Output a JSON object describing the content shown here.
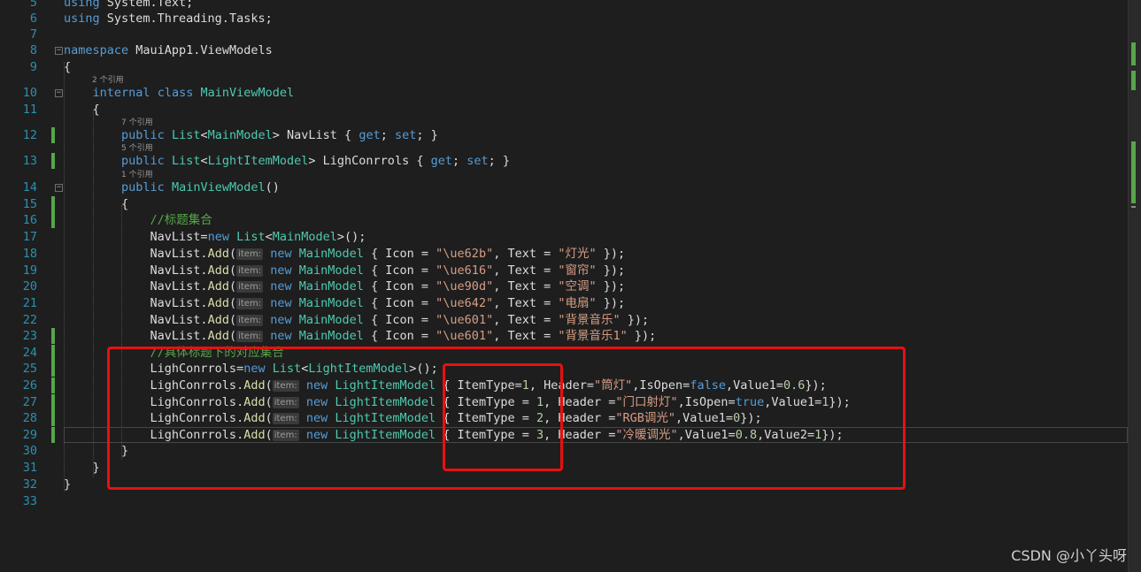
{
  "editor": {
    "lines": [
      {
        "n": "5",
        "tokens": [
          {
            "t": "using",
            "c": "kw"
          },
          {
            "t": " System.Text;"
          }
        ]
      },
      {
        "n": "6",
        "tokens": [
          {
            "t": "using",
            "c": "kw"
          },
          {
            "t": " System.Threading.Tasks;"
          }
        ]
      },
      {
        "n": "7",
        "tokens": []
      },
      {
        "n": "8",
        "tokens": [
          {
            "t": "namespace",
            "c": "kw"
          },
          {
            "t": " MauiApp1.ViewModels"
          }
        ]
      },
      {
        "n": "9",
        "tokens": [
          {
            "t": "{"
          }
        ]
      },
      {
        "n": "10",
        "lens": "2 个引用",
        "tokens": [
          {
            "t": "    "
          },
          {
            "t": "internal",
            "c": "kw"
          },
          {
            "t": " "
          },
          {
            "t": "class",
            "c": "kw"
          },
          {
            "t": " "
          },
          {
            "t": "MainViewModel",
            "c": "ty"
          }
        ]
      },
      {
        "n": "11",
        "tokens": [
          {
            "t": "    {"
          }
        ]
      },
      {
        "n": "12",
        "lens": "7 个引用",
        "tokens": [
          {
            "t": "        "
          },
          {
            "t": "public",
            "c": "kw"
          },
          {
            "t": " "
          },
          {
            "t": "List",
            "c": "ty"
          },
          {
            "t": "<"
          },
          {
            "t": "MainModel",
            "c": "ty"
          },
          {
            "t": "> NavList { "
          },
          {
            "t": "get",
            "c": "kw"
          },
          {
            "t": "; "
          },
          {
            "t": "set",
            "c": "kw"
          },
          {
            "t": "; }"
          }
        ]
      },
      {
        "n": "13",
        "lens": "5 个引用",
        "tokens": [
          {
            "t": "        "
          },
          {
            "t": "public",
            "c": "kw"
          },
          {
            "t": " "
          },
          {
            "t": "List",
            "c": "ty"
          },
          {
            "t": "<"
          },
          {
            "t": "LightItemModel",
            "c": "ty"
          },
          {
            "t": "> LighConrrols { "
          },
          {
            "t": "get",
            "c": "kw"
          },
          {
            "t": "; "
          },
          {
            "t": "set",
            "c": "kw"
          },
          {
            "t": "; }"
          }
        ]
      },
      {
        "n": "14",
        "lens": "1 个引用",
        "tokens": [
          {
            "t": "        "
          },
          {
            "t": "public",
            "c": "kw"
          },
          {
            "t": " "
          },
          {
            "t": "MainViewModel",
            "c": "ty"
          },
          {
            "t": "()"
          }
        ]
      },
      {
        "n": "15",
        "tokens": [
          {
            "t": "        {"
          }
        ]
      },
      {
        "n": "16",
        "tokens": [
          {
            "t": "            "
          },
          {
            "t": "//标题集合",
            "c": "cm"
          }
        ]
      },
      {
        "n": "17",
        "tokens": [
          {
            "t": "            NavList="
          },
          {
            "t": "new",
            "c": "kw"
          },
          {
            "t": " "
          },
          {
            "t": "List",
            "c": "ty"
          },
          {
            "t": "<"
          },
          {
            "t": "MainModel",
            "c": "ty"
          },
          {
            "t": ">();"
          }
        ]
      },
      {
        "n": "18",
        "tokens": [
          {
            "t": "            NavList."
          },
          {
            "t": "Add",
            "c": "mt"
          },
          {
            "t": "("
          },
          {
            "t": "item:",
            "c": "hint"
          },
          {
            "t": " "
          },
          {
            "t": "new",
            "c": "kw"
          },
          {
            "t": " "
          },
          {
            "t": "MainModel",
            "c": "ty"
          },
          {
            "t": " { Icon = "
          },
          {
            "t": "\"\\ue62b\"",
            "c": "st"
          },
          {
            "t": ", Text = "
          },
          {
            "t": "\"灯光\"",
            "c": "st"
          },
          {
            "t": " });"
          }
        ]
      },
      {
        "n": "19",
        "tokens": [
          {
            "t": "            NavList."
          },
          {
            "t": "Add",
            "c": "mt"
          },
          {
            "t": "("
          },
          {
            "t": "item:",
            "c": "hint"
          },
          {
            "t": " "
          },
          {
            "t": "new",
            "c": "kw"
          },
          {
            "t": " "
          },
          {
            "t": "MainModel",
            "c": "ty"
          },
          {
            "t": " { Icon = "
          },
          {
            "t": "\"\\ue616\"",
            "c": "st"
          },
          {
            "t": ", Text = "
          },
          {
            "t": "\"窗帘\"",
            "c": "st"
          },
          {
            "t": " });"
          }
        ]
      },
      {
        "n": "20",
        "tokens": [
          {
            "t": "            NavList."
          },
          {
            "t": "Add",
            "c": "mt"
          },
          {
            "t": "("
          },
          {
            "t": "item:",
            "c": "hint"
          },
          {
            "t": " "
          },
          {
            "t": "new",
            "c": "kw"
          },
          {
            "t": " "
          },
          {
            "t": "MainModel",
            "c": "ty"
          },
          {
            "t": " { Icon = "
          },
          {
            "t": "\"\\ue90d\"",
            "c": "st"
          },
          {
            "t": ", Text = "
          },
          {
            "t": "\"空调\"",
            "c": "st"
          },
          {
            "t": " });"
          }
        ]
      },
      {
        "n": "21",
        "tokens": [
          {
            "t": "            NavList."
          },
          {
            "t": "Add",
            "c": "mt"
          },
          {
            "t": "("
          },
          {
            "t": "item:",
            "c": "hint"
          },
          {
            "t": " "
          },
          {
            "t": "new",
            "c": "kw"
          },
          {
            "t": " "
          },
          {
            "t": "MainModel",
            "c": "ty"
          },
          {
            "t": " { Icon = "
          },
          {
            "t": "\"\\ue642\"",
            "c": "st"
          },
          {
            "t": ", Text = "
          },
          {
            "t": "\"电扇\"",
            "c": "st"
          },
          {
            "t": " });"
          }
        ]
      },
      {
        "n": "22",
        "tokens": [
          {
            "t": "            NavList."
          },
          {
            "t": "Add",
            "c": "mt"
          },
          {
            "t": "("
          },
          {
            "t": "item:",
            "c": "hint"
          },
          {
            "t": " "
          },
          {
            "t": "new",
            "c": "kw"
          },
          {
            "t": " "
          },
          {
            "t": "MainModel",
            "c": "ty"
          },
          {
            "t": " { Icon = "
          },
          {
            "t": "\"\\ue601\"",
            "c": "st"
          },
          {
            "t": ", Text = "
          },
          {
            "t": "\"背景音乐\"",
            "c": "st"
          },
          {
            "t": " });"
          }
        ]
      },
      {
        "n": "23",
        "tokens": [
          {
            "t": "            NavList."
          },
          {
            "t": "Add",
            "c": "mt"
          },
          {
            "t": "("
          },
          {
            "t": "item:",
            "c": "hint"
          },
          {
            "t": " "
          },
          {
            "t": "new",
            "c": "kw"
          },
          {
            "t": " "
          },
          {
            "t": "MainModel",
            "c": "ty"
          },
          {
            "t": " { Icon = "
          },
          {
            "t": "\"\\ue601\"",
            "c": "st"
          },
          {
            "t": ", Text = "
          },
          {
            "t": "\"背景音乐1\"",
            "c": "st"
          },
          {
            "t": " });"
          }
        ]
      },
      {
        "n": "24",
        "tokens": [
          {
            "t": "            "
          },
          {
            "t": "//具体标题下的对应集合",
            "c": "cm"
          }
        ]
      },
      {
        "n": "25",
        "tokens": [
          {
            "t": "            LighConrrols="
          },
          {
            "t": "new",
            "c": "kw"
          },
          {
            "t": " "
          },
          {
            "t": "List",
            "c": "ty"
          },
          {
            "t": "<"
          },
          {
            "t": "LightItemModel",
            "c": "ty"
          },
          {
            "t": ">();"
          }
        ]
      },
      {
        "n": "26",
        "tokens": [
          {
            "t": "            LighConrrols."
          },
          {
            "t": "Add",
            "c": "mt"
          },
          {
            "t": "("
          },
          {
            "t": "item:",
            "c": "hint"
          },
          {
            "t": " "
          },
          {
            "t": "new",
            "c": "kw"
          },
          {
            "t": " "
          },
          {
            "t": "LightItemModel",
            "c": "ty"
          },
          {
            "t": " { ItemType="
          },
          {
            "t": "1",
            "c": "nu"
          },
          {
            "t": ", Header="
          },
          {
            "t": "\"筒灯\"",
            "c": "st"
          },
          {
            "t": ",IsOpen="
          },
          {
            "t": "false",
            "c": "kw"
          },
          {
            "t": ",Value1="
          },
          {
            "t": "0.6",
            "c": "nu"
          },
          {
            "t": "});"
          }
        ]
      },
      {
        "n": "27",
        "tokens": [
          {
            "t": "            LighConrrols."
          },
          {
            "t": "Add",
            "c": "mt"
          },
          {
            "t": "("
          },
          {
            "t": "item:",
            "c": "hint"
          },
          {
            "t": " "
          },
          {
            "t": "new",
            "c": "kw"
          },
          {
            "t": " "
          },
          {
            "t": "LightItemModel",
            "c": "ty"
          },
          {
            "t": " { ItemType = "
          },
          {
            "t": "1",
            "c": "nu"
          },
          {
            "t": ", Header ="
          },
          {
            "t": "\"门口射灯\"",
            "c": "st"
          },
          {
            "t": ",IsOpen="
          },
          {
            "t": "true",
            "c": "kw"
          },
          {
            "t": ",Value1="
          },
          {
            "t": "1",
            "c": "nu"
          },
          {
            "t": "});"
          }
        ]
      },
      {
        "n": "28",
        "tokens": [
          {
            "t": "            LighConrrols."
          },
          {
            "t": "Add",
            "c": "mt"
          },
          {
            "t": "("
          },
          {
            "t": "item:",
            "c": "hint"
          },
          {
            "t": " "
          },
          {
            "t": "new",
            "c": "kw"
          },
          {
            "t": " "
          },
          {
            "t": "LightItemModel",
            "c": "ty"
          },
          {
            "t": " { ItemType = "
          },
          {
            "t": "2",
            "c": "nu"
          },
          {
            "t": ", Header ="
          },
          {
            "t": "\"RGB调光\"",
            "c": "st"
          },
          {
            "t": ",Value1="
          },
          {
            "t": "0",
            "c": "nu"
          },
          {
            "t": "});"
          }
        ]
      },
      {
        "n": "29",
        "tokens": [
          {
            "t": "            LighConrrols."
          },
          {
            "t": "Add",
            "c": "mt"
          },
          {
            "t": "("
          },
          {
            "t": "item:",
            "c": "hint"
          },
          {
            "t": " "
          },
          {
            "t": "new",
            "c": "kw"
          },
          {
            "t": " "
          },
          {
            "t": "LightItemModel",
            "c": "ty"
          },
          {
            "t": " { ItemType = "
          },
          {
            "t": "3",
            "c": "nu"
          },
          {
            "t": ", Header ="
          },
          {
            "t": "\"冷暖调光\"",
            "c": "st"
          },
          {
            "t": ",Value1="
          },
          {
            "t": "0.8",
            "c": "nu"
          },
          {
            "t": ",Value2="
          },
          {
            "t": "1",
            "c": "nu"
          },
          {
            "t": "});"
          }
        ]
      },
      {
        "n": "30",
        "tokens": [
          {
            "t": "        }"
          }
        ]
      },
      {
        "n": "31",
        "tokens": [
          {
            "t": "    }"
          }
        ]
      },
      {
        "n": "32",
        "tokens": [
          {
            "t": "}"
          }
        ]
      },
      {
        "n": "33",
        "tokens": []
      }
    ]
  },
  "watermark": "CSDN @小丫头呀",
  "colors": {
    "background": "#1e1e1e",
    "line_number": "#2b91af",
    "keyword": "#569cd6",
    "type": "#4ec9b0",
    "string": "#d69d85",
    "comment": "#57a64a",
    "number": "#b5cea8",
    "method": "#dcdcaa",
    "annotation": "#e81010"
  }
}
